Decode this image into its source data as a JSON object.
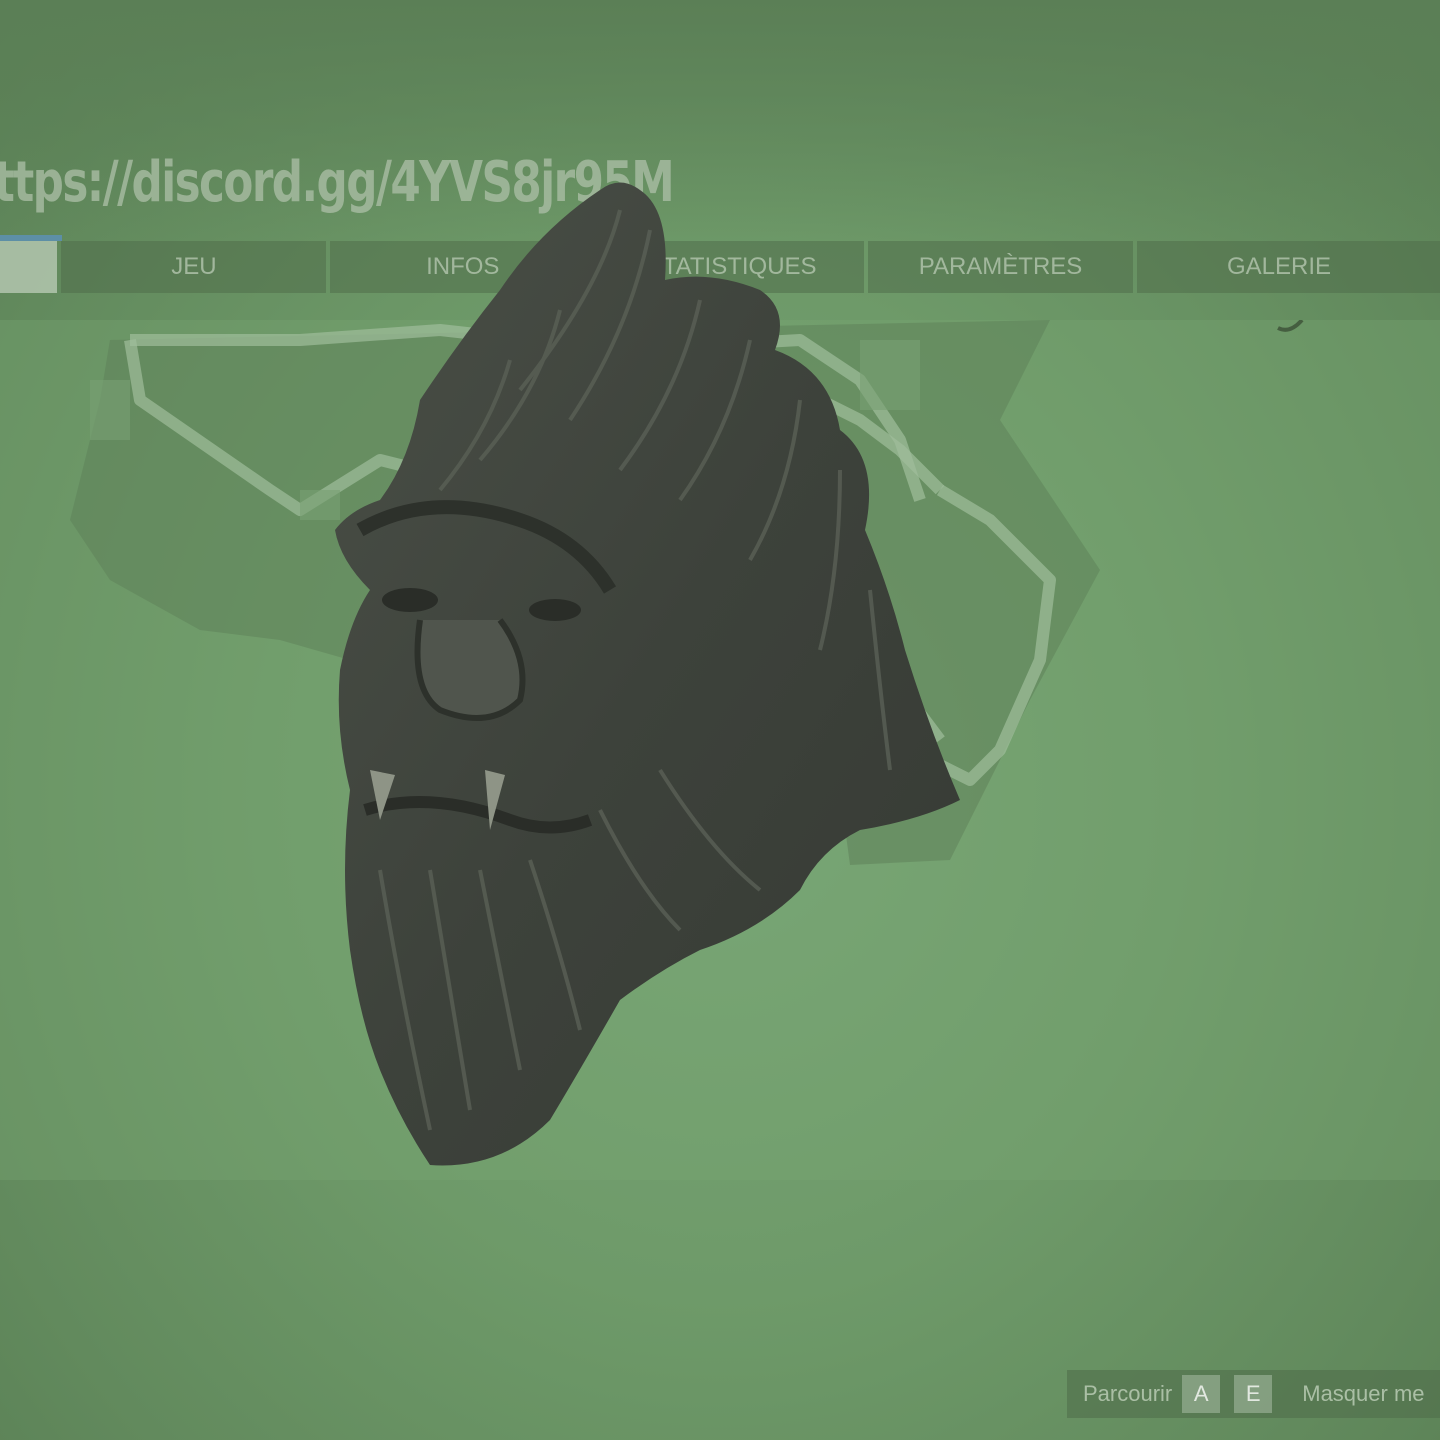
{
  "banner": {
    "text": "ttps://discord.gg/4YVS8jr95M"
  },
  "tabs": [
    {
      "label": ""
    },
    {
      "label": "JEU"
    },
    {
      "label": "INFOS"
    },
    {
      "label": "STATISTIQUES"
    },
    {
      "label": "PARAMÈTRES"
    },
    {
      "label": "GALERIE"
    }
  ],
  "main": {
    "map_icon": "island-map-icon",
    "mask_icon": "bigfoot-mask-icon"
  },
  "help": {
    "browse_label": "Parcourir",
    "key_a": "A",
    "key_e": "E",
    "hide_label": "Masquer me"
  },
  "colors": {
    "background": "#6f9a6a",
    "tab_bg": "#506e4b",
    "tab_text": "#aabea5",
    "active_indicator": "#5d8fa6",
    "mask": "#3f433d"
  }
}
